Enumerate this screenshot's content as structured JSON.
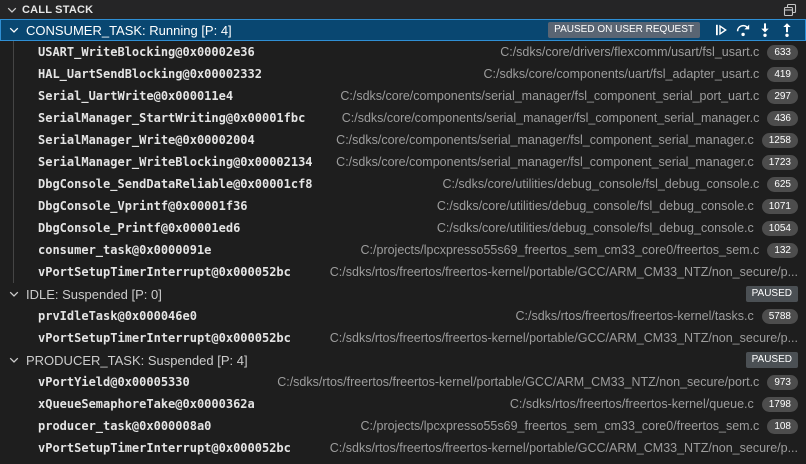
{
  "panel": {
    "title": "CALL STACK",
    "header_icon": "open-editors-icon"
  },
  "debug_actions": {
    "status_badge": "PAUSED ON USER REQUEST",
    "buttons": [
      "continue",
      "step-over",
      "step-into",
      "step-out"
    ]
  },
  "colors": {
    "panel_bg": "#1e1e1e",
    "header_bg": "#252526",
    "selected_row_bg": "#094771",
    "selected_row_border": "#2f8fd4",
    "line_badge_bg": "#4d4d4d",
    "paused_badge_bg": "#4b5054",
    "path_text": "#9d9d9d",
    "function_text": "#e4e4e4"
  },
  "threads": [
    {
      "label": "CONSUMER_TASK: Running [P: 4]",
      "state_badge": "PAUSED ON USER REQUEST",
      "selected": true,
      "frames": [
        {
          "name": "USART_WriteBlocking@0x00002e36",
          "path": "C:/sdks/core/drivers/flexcomm/usart/fsl_usart.c",
          "line": "633"
        },
        {
          "name": "HAL_UartSendBlocking@0x00002332",
          "path": "C:/sdks/core/components/uart/fsl_adapter_usart.c",
          "line": "419"
        },
        {
          "name": "Serial_UartWrite@0x000011e4",
          "path": "C:/sdks/core/components/serial_manager/fsl_component_serial_port_uart.c",
          "line": "297"
        },
        {
          "name": "SerialManager_StartWriting@0x00001fbc",
          "path": "C:/sdks/core/components/serial_manager/fsl_component_serial_manager.c",
          "line": "436"
        },
        {
          "name": "SerialManager_Write@0x00002004",
          "path": "C:/sdks/core/components/serial_manager/fsl_component_serial_manager.c",
          "line": "1258"
        },
        {
          "name": "SerialManager_WriteBlocking@0x00002134",
          "path": "C:/sdks/core/components/serial_manager/fsl_component_serial_manager.c",
          "line": "1723"
        },
        {
          "name": "DbgConsole_SendDataReliable@0x00001cf8",
          "path": "C:/sdks/core/utilities/debug_console/fsl_debug_console.c",
          "line": "625"
        },
        {
          "name": "DbgConsole_Vprintf@0x00001f36",
          "path": "C:/sdks/core/utilities/debug_console/fsl_debug_console.c",
          "line": "1071"
        },
        {
          "name": "DbgConsole_Printf@0x00001ed6",
          "path": "C:/sdks/core/utilities/debug_console/fsl_debug_console.c",
          "line": "1054"
        },
        {
          "name": "consumer_task@0x0000091e",
          "path": "C:/projects/lpcxpresso55s69_freertos_sem_cm33_core0/freertos_sem.c",
          "line": "132"
        },
        {
          "name": "vPortSetupTimerInterrupt@0x000052bc",
          "path": "C:/sdks/rtos/freertos/freertos-kernel/portable/GCC/ARM_CM33_NTZ/non_secure/p..."
        }
      ]
    },
    {
      "label": "IDLE: Suspended [P: 0]",
      "state_badge": "PAUSED",
      "selected": false,
      "frames": [
        {
          "name": "prvIdleTask@0x000046e0",
          "path": "C:/sdks/rtos/freertos/freertos-kernel/tasks.c",
          "line": "5788"
        },
        {
          "name": "vPortSetupTimerInterrupt@0x000052bc",
          "path": "C:/sdks/rtos/freertos/freertos-kernel/portable/GCC/ARM_CM33_NTZ/non_secure/p..."
        }
      ]
    },
    {
      "label": "PRODUCER_TASK: Suspended [P: 4]",
      "state_badge": "PAUSED",
      "selected": false,
      "frames": [
        {
          "name": "vPortYield@0x00005330",
          "path": "C:/sdks/rtos/freertos/freertos-kernel/portable/GCC/ARM_CM33_NTZ/non_secure/port.c",
          "line": "973"
        },
        {
          "name": "xQueueSemaphoreTake@0x0000362a",
          "path": "C:/sdks/rtos/freertos/freertos-kernel/queue.c",
          "line": "1798"
        },
        {
          "name": "producer_task@0x000008a0",
          "path": "C:/projects/lpcxpresso55s69_freertos_sem_cm33_core0/freertos_sem.c",
          "line": "108"
        },
        {
          "name": "vPortSetupTimerInterrupt@0x000052bc",
          "path": "C:/sdks/rtos/freertos/freertos-kernel/portable/GCC/ARM_CM33_NTZ/non_secure/p..."
        }
      ]
    }
  ]
}
